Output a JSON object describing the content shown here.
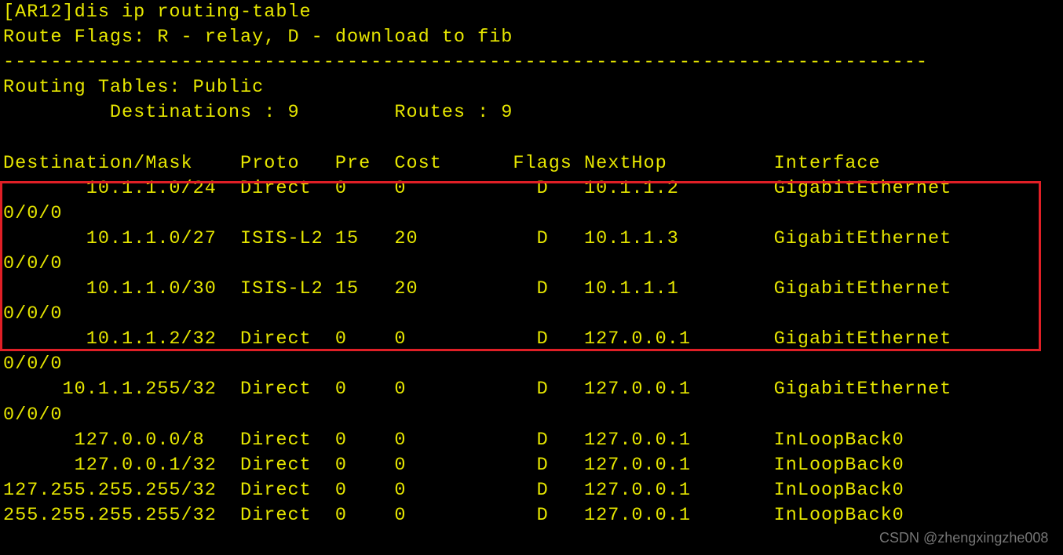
{
  "theme": {
    "background": "#000000",
    "text_color": "#e6e600",
    "highlight_border": "#e01f26",
    "watermark_color": "#8a8a8a"
  },
  "header": {
    "command_line": "[AR12]dis ip routing-table",
    "flags_line": "Route Flags: R - relay, D - download to fib",
    "separator": "------------------------------------------------------------------------------",
    "tables_line": "Routing Tables: Public",
    "summary_line": "         Destinations : 9        Routes : 9"
  },
  "table": {
    "header_line": "Destination/Mask    Proto   Pre  Cost      Flags NextHop         Interface",
    "rows": [
      {
        "line": "       10.1.1.0/24  Direct  0    0           D   10.1.1.2        GigabitEthernet",
        "cont": "0/0/0"
      },
      {
        "line": "       10.1.1.0/27  ISIS-L2 15   20          D   10.1.1.3        GigabitEthernet",
        "cont": "0/0/0"
      },
      {
        "line": "       10.1.1.0/30  ISIS-L2 15   20          D   10.1.1.1        GigabitEthernet",
        "cont": "0/0/0"
      },
      {
        "line": "       10.1.1.2/32  Direct  0    0           D   127.0.0.1       GigabitEthernet",
        "cont": "0/0/0"
      },
      {
        "line": "     10.1.1.255/32  Direct  0    0           D   127.0.0.1       GigabitEthernet",
        "cont": "0/0/0"
      },
      {
        "line": "      127.0.0.0/8   Direct  0    0           D   127.0.0.1       InLoopBack0",
        "cont": null
      },
      {
        "line": "      127.0.0.1/32  Direct  0    0           D   127.0.0.1       InLoopBack0",
        "cont": null
      },
      {
        "line": "127.255.255.255/32  Direct  0    0           D   127.0.0.1       InLoopBack0",
        "cont": null
      },
      {
        "line": "255.255.255.255/32  Direct  0    0           D   127.0.0.1       InLoopBack0",
        "cont": null
      }
    ]
  },
  "watermark": {
    "text": "CSDN @zhengxingzhe008"
  }
}
